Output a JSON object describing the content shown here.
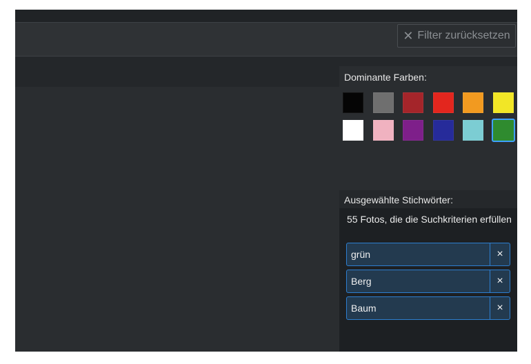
{
  "toolbar": {
    "reset_label": "Filter zurücksetzen",
    "reset_icon": "close-icon"
  },
  "colors": {
    "title": "Dominante Farben:",
    "swatches": [
      {
        "name": "swatch-black",
        "color": "#050505"
      },
      {
        "name": "swatch-gray",
        "color": "#6f6f6f"
      },
      {
        "name": "swatch-dark-red",
        "color": "#a4252a"
      },
      {
        "name": "swatch-red",
        "color": "#e3261e"
      },
      {
        "name": "swatch-orange",
        "color": "#f29a20"
      },
      {
        "name": "swatch-yellow",
        "color": "#f2e626"
      },
      {
        "name": "swatch-white",
        "color": "#ffffff"
      },
      {
        "name": "swatch-pink",
        "color": "#f0b2c0"
      },
      {
        "name": "swatch-purple",
        "color": "#7e1f8a"
      },
      {
        "name": "swatch-blue",
        "color": "#262b9a"
      },
      {
        "name": "swatch-light-blue",
        "color": "#7ccdd3"
      },
      {
        "name": "swatch-green",
        "color": "#2f8b2f",
        "selected": true
      }
    ]
  },
  "keywords": {
    "title": "Ausgewählte Stichwörter:",
    "count_text": "55 Fotos, die die Suchkriterien erfüllen",
    "items": [
      {
        "label": "grün",
        "remove": "×"
      },
      {
        "label": "Berg",
        "remove": "×"
      },
      {
        "label": "Baum",
        "remove": "×"
      }
    ]
  }
}
